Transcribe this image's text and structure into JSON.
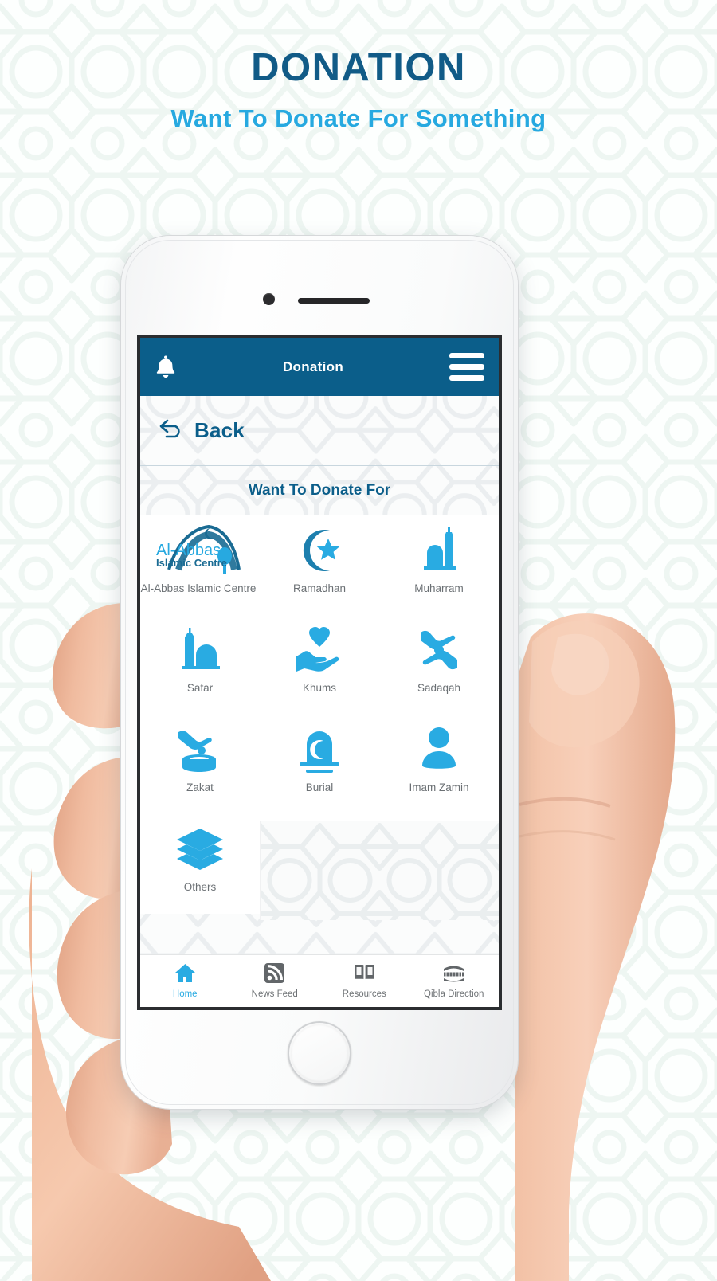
{
  "poster": {
    "title": "DONATION",
    "subtitle": "Want To Donate For Something",
    "title_color": "#115b87",
    "subtitle_color": "#27a9e0",
    "background_color": "#fdfffe"
  },
  "app": {
    "bar": {
      "title": "Donation",
      "bar_color": "#0b5e8a",
      "notifications_icon": "bell-icon",
      "menu_icon": "hamburger-menu-icon"
    },
    "back": {
      "label": "Back",
      "icon": "back-arrow-icon",
      "color": "#0b5e8a"
    },
    "section": {
      "title": "Want To Donate For"
    },
    "accent_color": "#29abe2",
    "donation_options": [
      {
        "label": "Al-Abbas Islamic Centre",
        "icon": "al-abbas-logo-icon"
      },
      {
        "label": "Ramadhan",
        "icon": "crescent-star-icon"
      },
      {
        "label": "Muharram",
        "icon": "mosque-minaret-icon"
      },
      {
        "label": "Safar",
        "icon": "mosque-dome-icon"
      },
      {
        "label": "Khums",
        "icon": "hand-heart-icon"
      },
      {
        "label": "Sadaqah",
        "icon": "two-hands-coin-icon"
      },
      {
        "label": "Zakat",
        "icon": "hand-coin-box-icon"
      },
      {
        "label": "Burial",
        "icon": "tombstone-crescent-icon"
      },
      {
        "label": "Imam Zamin",
        "icon": "person-icon"
      },
      {
        "label": "Others",
        "icon": "layers-icon"
      }
    ],
    "logo": {
      "line1": "Al-Abbas",
      "line2": "Islamic Centre"
    },
    "bottom_nav": [
      {
        "label": "Home",
        "icon": "home-icon",
        "active": true
      },
      {
        "label": "News Feed",
        "icon": "rss-feed-icon",
        "active": false
      },
      {
        "label": "Resources",
        "icon": "open-book-icon",
        "active": false
      },
      {
        "label": "Qibla Direction",
        "icon": "kaaba-icon",
        "active": false
      }
    ]
  }
}
